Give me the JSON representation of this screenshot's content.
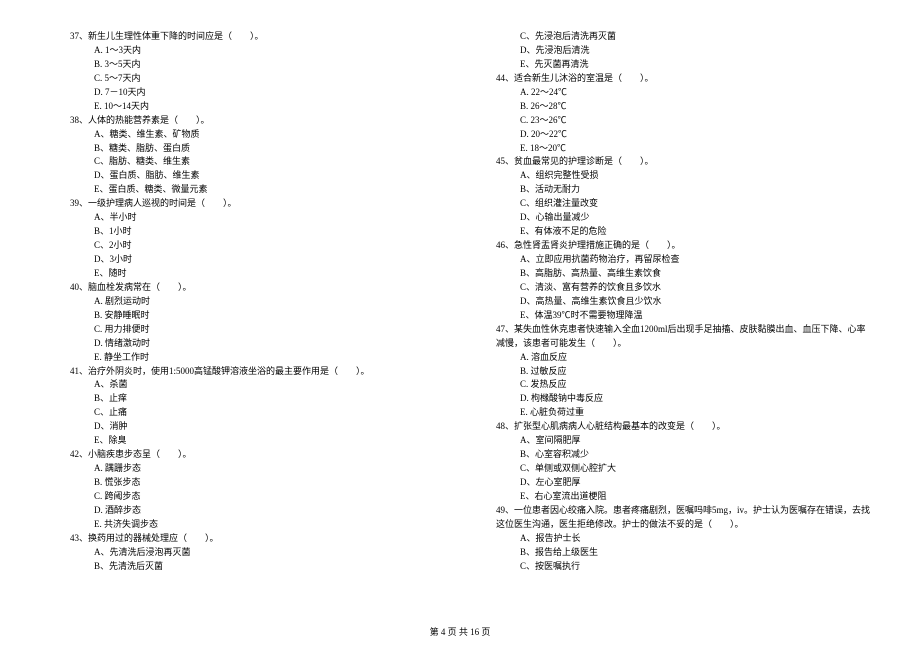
{
  "left": {
    "q37": {
      "text": "37、新生儿生理性体重下降的时间应是（　　）。",
      "opts": [
        "A. 1～3天内",
        "B. 3～5天内",
        "C. 5～7天内",
        "D. 7－10天内",
        "E. 10～14天内"
      ]
    },
    "q38": {
      "text": "38、人体的热能营养素是（　　）。",
      "opts": [
        "A、糖类、维生素、矿物质",
        "B、糖类、脂肪、蛋白质",
        "C、脂肪、糖类、维生素",
        "D、蛋白质、脂肪、维生素",
        "E、蛋白质、糖类、微量元素"
      ]
    },
    "q39": {
      "text": "39、一级护理病人巡视的时间是（　　）。",
      "opts": [
        "A、半小时",
        "B、1小时",
        "C、2小时",
        "D、3小时",
        "E、随时"
      ]
    },
    "q40": {
      "text": "40、脑血栓发病常在（　　）。",
      "opts": [
        "A. 剧烈运动时",
        "B. 安静睡眠时",
        "C. 用力排便时",
        "D. 情绪激动时",
        "E. 静坐工作时"
      ]
    },
    "q41": {
      "text": "41、治疗外阴炎时，使用1:5000高锰酸钾溶液坐浴的最主要作用是（　　）。",
      "opts": [
        "A、杀菌",
        "B、止痒",
        "C、止痛",
        "D、消肿",
        "E、除臭"
      ]
    },
    "q42": {
      "text": "42、小脑疾患步态呈（　　）。",
      "opts": [
        "A. 蹒跚步态",
        "B. 慌张步态",
        "C. 跨阈步态",
        "D. 酒醉步态",
        "E. 共济失调步态"
      ]
    },
    "q43": {
      "text": "43、换药用过的器械处理应（　　）。",
      "opts": [
        "A、先清洗后浸泡再灭菌",
        "B、先清洗后灭菌"
      ]
    }
  },
  "right": {
    "q43cont": {
      "opts": [
        "C、先浸泡后清洗再灭菌",
        "D、先浸泡后清洗",
        "E、先灭菌再清洗"
      ]
    },
    "q44": {
      "text": "44、适合新生儿沐浴的室温是（　　）。",
      "opts": [
        "A. 22～24℃",
        "B. 26～28℃",
        "C. 23～26℃",
        "D. 20～22℃",
        "E. 18～20℃"
      ]
    },
    "q45": {
      "text": "45、贫血最常见的护理诊断是（　　）。",
      "opts": [
        "A、组织完整性受损",
        "B、活动无耐力",
        "C、组织灌注量改变",
        "D、心输出量减少",
        "E、有体液不足的危险"
      ]
    },
    "q46": {
      "text": "46、急性肾盂肾炎护理措施正确的是（　　）。",
      "opts": [
        "A、立即应用抗菌药物治疗，再留尿检查",
        "B、高脂肪、高热量、高维生素饮食",
        "C、清淡、富有营养的饮食且多饮水",
        "D、高热量、高维生素饮食且少饮水",
        "E、体温39℃时不需要物理降温"
      ]
    },
    "q47": {
      "text": "47、某失血性休克患者快速输入全血1200ml后出现手足抽搐、皮肤黏膜出血、血压下降、心率",
      "text2": "减慢，该患者可能发生（　　）。",
      "opts": [
        "A. 溶血反应",
        "B. 过敏反应",
        "C. 发热反应",
        "D. 枸橼酸钠中毒反应",
        "E. 心脏负荷过重"
      ]
    },
    "q48": {
      "text": "48、扩张型心肌病病人心脏结构最基本的改变是（　　）。",
      "opts": [
        "A、室间隔肥厚",
        "B、心室容积减少",
        "C、单侧或双侧心腔扩大",
        "D、左心室肥厚",
        "E、右心室流出道梗阻"
      ]
    },
    "q49": {
      "text": "49、一位患者因心绞痛入院。患者疼痛剧烈，医嘱吗啡5mg，iv。护士认为医嘱存在错误，去找",
      "text2": "这位医生沟通，医生拒绝修改。护士的做法不妥的是（　　）。",
      "opts": [
        "A、报告护士长",
        "B、报告给上级医生",
        "C、按医嘱执行"
      ]
    }
  },
  "footer": "第 4 页 共 16 页"
}
